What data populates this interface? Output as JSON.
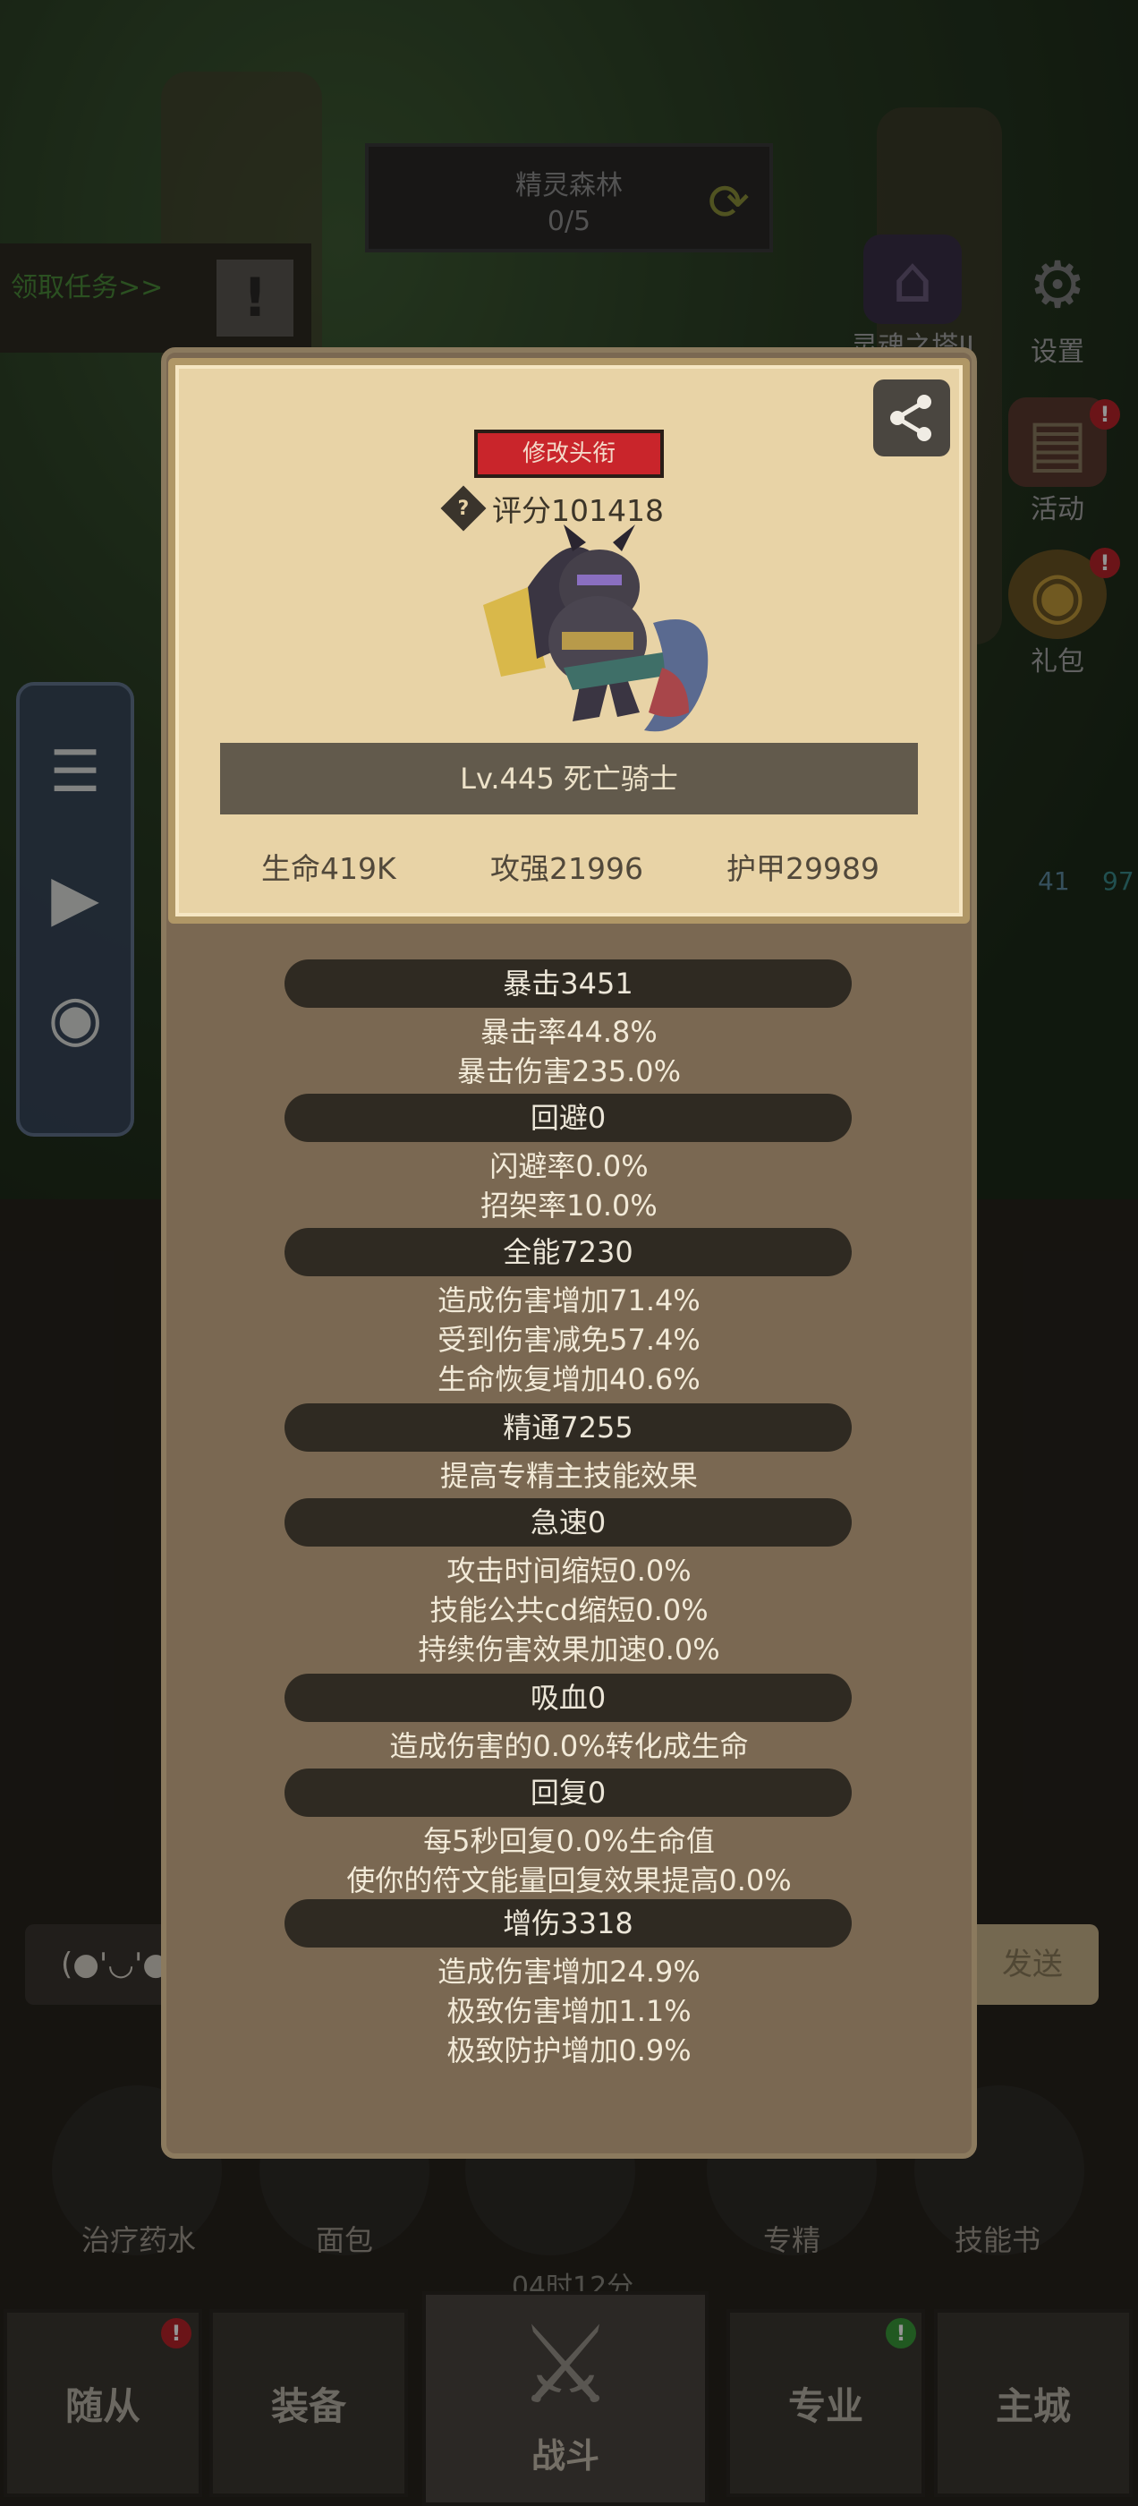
{
  "stage": {
    "name": "精灵森林",
    "progress": "0/5",
    "refresh_icon": "refresh-arrows-icon"
  },
  "quest": {
    "label": "领取任务>>",
    "alert_glyph": "!"
  },
  "right_menu": {
    "tower_label": "灵魂之塔II",
    "settings_label": "设置",
    "event_label": "活动",
    "gift_label": "礼包",
    "badge_glyph": "!"
  },
  "level_readout": {
    "left": "41",
    "right": "97"
  },
  "profile": {
    "edit_title_label": "修改头衔",
    "score_icon_glyph": "?",
    "score_text": "评分101418",
    "name_text": "Lv.445 死亡骑士",
    "stats": {
      "hp": "生命419K",
      "attack": "攻强21996",
      "armor": "护甲29989"
    }
  },
  "sections": [
    {
      "title": "暴击3451",
      "lines": [
        "暴击率44.8%",
        "暴击伤害235.0%"
      ]
    },
    {
      "title": "回避0",
      "lines": [
        "闪避率0.0%",
        "招架率10.0%"
      ]
    },
    {
      "title": "全能7230",
      "lines": [
        "造成伤害增加71.4%",
        "受到伤害减免57.4%",
        "生命恢复增加40.6%"
      ]
    },
    {
      "title": "精通7255",
      "lines": [
        "提高专精主技能效果"
      ]
    },
    {
      "title": "急速0",
      "lines": [
        "攻击时间缩短0.0%",
        "技能公共cd缩短0.0%",
        "持续伤害效果加速0.0%"
      ]
    },
    {
      "title": "吸血0",
      "lines": [
        "造成伤害的0.0%转化成生命"
      ]
    },
    {
      "title": "回复0",
      "lines": [
        "每5秒回复0.0%生命值",
        "使你的符文能量回复效果提高0.0%"
      ]
    },
    {
      "title": "增伤3318",
      "lines": [
        "造成伤害增加24.9%",
        "极致伤害增加1.1%",
        "极致防护增加0.9%"
      ]
    }
  ],
  "chat": {
    "emote": "(●'◡'●",
    "send_label": "发送"
  },
  "quick_items": [
    "治疗药水",
    "面包",
    "专精",
    "技能书"
  ],
  "timer": "04时12分",
  "tabs": {
    "companions": "随从",
    "equipment": "装备",
    "battle": "战斗",
    "profession": "专业",
    "main_city": "主城"
  },
  "colors": {
    "accent_red": "#c9252b",
    "parchment": "#e8d3a6",
    "panel": "#7a6852"
  }
}
